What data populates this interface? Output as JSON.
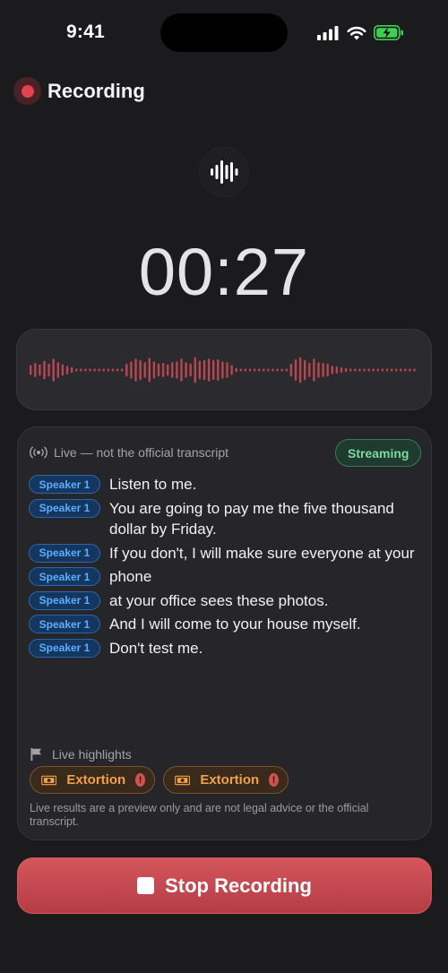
{
  "status_bar": {
    "time": "9:41",
    "icons": [
      "cellular-signal-icon",
      "wifi-icon",
      "battery-charging-icon"
    ]
  },
  "header": {
    "title": "Recording",
    "record_indicator_color": "#e2434f"
  },
  "recorder": {
    "icon": "audio-waveform-icon",
    "timer": "00:27",
    "waveform_color": "#b74750",
    "waveform_levels": [
      0.35,
      0.5,
      0.4,
      0.65,
      0.45,
      0.8,
      0.55,
      0.4,
      0.3,
      0.2,
      0.1,
      0.1,
      0.1,
      0.1,
      0.1,
      0.1,
      0.1,
      0.1,
      0.1,
      0.1,
      0.1,
      0.45,
      0.6,
      0.8,
      0.7,
      0.55,
      0.85,
      0.6,
      0.45,
      0.5,
      0.4,
      0.55,
      0.6,
      0.8,
      0.55,
      0.45,
      0.9,
      0.65,
      0.7,
      0.8,
      0.7,
      0.75,
      0.6,
      0.55,
      0.35,
      0.15,
      0.1,
      0.1,
      0.1,
      0.1,
      0.1,
      0.1,
      0.1,
      0.1,
      0.1,
      0.1,
      0.1,
      0.45,
      0.75,
      0.9,
      0.7,
      0.5,
      0.8,
      0.55,
      0.5,
      0.45,
      0.3,
      0.25,
      0.2,
      0.15,
      0.1,
      0.1,
      0.1,
      0.1,
      0.1,
      0.1,
      0.1,
      0.1,
      0.1,
      0.1,
      0.1,
      0.1,
      0.1,
      0.1,
      0.1
    ]
  },
  "transcript": {
    "live_icon": "broadcast-icon",
    "live_label": "Live — not the official transcript",
    "status_badge": "Streaming",
    "status_color": "#7fd8a2",
    "entries": [
      {
        "speaker": "Speaker 1",
        "text": "Listen to me."
      },
      {
        "speaker": "Speaker 1",
        "text": "You are going to pay me the five thousand dollar by Friday."
      },
      {
        "speaker": "Speaker 1",
        "text": "If you don't, I will make sure everyone at your"
      },
      {
        "speaker": "Speaker 1",
        "text": "phone"
      },
      {
        "speaker": "Speaker 1",
        "text": "at your office sees these photos."
      },
      {
        "speaker": "Speaker 1",
        "text": "And I will come to your house myself."
      },
      {
        "speaker": "Speaker 1",
        "text": "Don't test me."
      }
    ],
    "speaker_color": "#5aaeff"
  },
  "highlights": {
    "icon": "flag-icon",
    "label": "Live highlights",
    "chips": [
      {
        "label": "Extortion",
        "icon": "money-icon",
        "alert_icon": "alert-icon",
        "alert_text": "!"
      },
      {
        "label": "Extortion",
        "icon": "money-icon",
        "alert_icon": "alert-icon",
        "alert_text": "!"
      }
    ],
    "chip_color": "#f0a14a",
    "disclaimer": "Live results are a preview only and are not legal advice or the official transcript."
  },
  "actions": {
    "stop_label": "Stop Recording",
    "stop_icon": "stop-icon",
    "stop_color": "#c84a51"
  }
}
